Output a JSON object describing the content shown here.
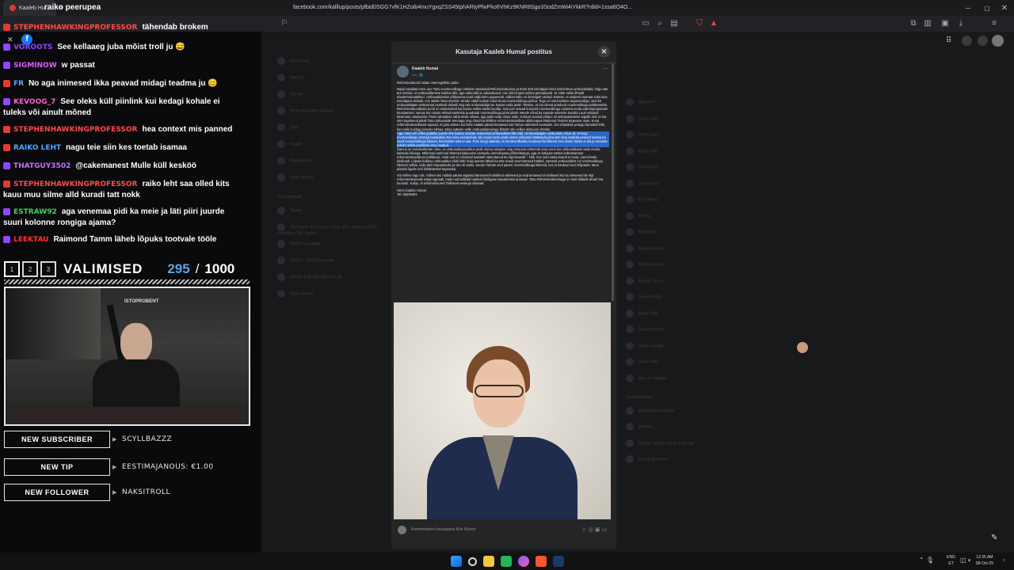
{
  "browser": {
    "tab_title": "Kaaleb Hu...",
    "stream_title": "raiko peerupea",
    "url": "facebook.com/kalllup/posts/pfbid0SGG7vfK1HZoib4muYgxqZSS45tphARtyPfwPko6VhKz9KNR8Sgo3SodZmWi4iYkkR?rdid=1ssa6O4O..."
  },
  "chat": [
    {
      "user": "STEPHENHAWKINGPROFESSOR",
      "text": "tähendab brokem",
      "color": "#ff4a4a",
      "platform": "youtube"
    },
    {
      "user": "VOROOTS",
      "text": "See kellaaeg juba mõist troll ju 😅",
      "color": "#9146ff",
      "platform": "twitch"
    },
    {
      "user": "SIGMINOW",
      "text": "w passat",
      "color": "#e05cff",
      "platform": "twitch"
    },
    {
      "user": "FR",
      "text": "No aga inimesed ikka peavad midagi teadma ju 😊",
      "color": "#4aa8ff",
      "platform": "youtube"
    },
    {
      "user": "KEVOOG_7",
      "text": "See oleks küll piinlink kui kedagi kohale ei tuleks või ainult mõned",
      "color": "#ff5cd2",
      "platform": "twitch"
    },
    {
      "user": "STEPHENHAWKINGPROFESSOR",
      "text": "hea context mis panned",
      "color": "#ff4a4a",
      "platform": "youtube"
    },
    {
      "user": "RAIKO LEHT",
      "text": "nagu teie siin kes toetab isamaa",
      "color": "#4aa8ff",
      "platform": "youtube"
    },
    {
      "user": "THATGUY3502",
      "text": "@cakemanest Mulle küll kesköö",
      "color": "#c070ff",
      "platform": "twitch"
    },
    {
      "user": "STEPHENHAWKINGPROFESSOR",
      "text": "raiko leht saa olled kits kauu muu silme alld kuradi tatt nokk",
      "color": "#ff4a4a",
      "platform": "youtube"
    },
    {
      "user": "ESTRAW92",
      "text": "aga venemaa pidi ka meie ja läti piiri juurde suuri kolonne rongiga ajama?",
      "color": "#3fd15c",
      "platform": "twitch"
    },
    {
      "user": "LEEKTAU",
      "text": "Raimond Tamm läheb lõpuks tootvale tööle",
      "color": "#ff3030",
      "platform": "twitch"
    }
  ],
  "overlay": {
    "tabs": [
      "1",
      "2",
      "3"
    ],
    "title": "VALIMISED",
    "count": "295",
    "slash": "/",
    "total": "1000",
    "cam_label": "ISTOPROBENT",
    "alerts": [
      {
        "label": "NEW SUBSCRIBER",
        "value": "SCYLLBAZZZ"
      },
      {
        "label": "NEW TIP",
        "value": "EESTIMAJANOUS: €1.00"
      },
      {
        "label": "NEW FOLLOWER",
        "value": "NAKSITROLL"
      }
    ]
  },
  "facebook": {
    "left_nav": [
      "Kris Kärner",
      "Meta AI",
      "Sõbrad",
      "Professionaalne töölaud",
      "Vaist",
      "Grupid",
      "Marketplace",
      "Kuva rohkem",
      "Sinu otseteed",
      "Teated",
      "Ühis ma/a: Kris Kärner (Tartu 4EK valimised 2025 - Kandidaat 1/4 - Aston)",
      "ÜKSIV Kooselige",
      "TARTU - Üldis/00 kulaste",
      "ÜDSIK & MÕÕN TARTUS (A)",
      "Kuva rohkem"
    ],
    "right_contacts": [
      "Meta AI P",
      "Saliss Fish",
      "Ümnet Saar",
      "Madis SiIP",
      "Rollo Agoo",
      "Jaanus Kivi",
      "Enel Mang",
      "Ele Sa",
      "Erik Aland",
      "Kaaleb Humal",
      "Kristjan Kosiik",
      "Kaspar Tamm",
      "Leena Rõõps",
      "Martin Pikk",
      "Sandri Hannek",
      "Oliver Kuodde",
      "Ünne Rebo",
      "Ants de Kallaste",
      "Grupivestlused",
      "Maidande Kelnoldsk",
      "Bärenfo",
      "Chadd, Sanlan Karl ja 4 teisega",
      "Uus grupivestlus"
    ],
    "modal_title": "Kasutaja Kaaleb Humal postitus",
    "author": "Kaaleb Humal",
    "time": "1 h · 🌐",
    "post": {
      "p1": "Reformierakond näitas oma tegelikku palet",
      "p2": "Napid nädalad enne uue Tartu noortevolikogu valimist otsustasid Reformierakonna ja Eesti 200 esindajad mind esimehena umbusaldada. Olgu ette ära öeldud, et umbusaldamine kukkus läbi, aga vahendid ja vabandused, mis olid kergeit öeldes jahmatavad. Et mitte öelda lihtsalt ebademokraatlikud. Umbusaldamise põhjusena toodi välja kolm argumenti, millest kaks on ilmselgelt otsitud: Esiteks, et osalesin Isamaa erakonna esindajana debatil, mis rääkis Tartu ööelust. Nende väitel kutsuti mind sinna noortevolikogu juhina. Tegu on naeruväärse argumendiga, sest ka umbusaldajate erakonnad osalesid debatil ning üks umbusaldaja ise kuulas seda pealt. Teiseks, et ma olevat püüdnud noortevolikogu politiseerida. Reformierakondlaste poolt on erakondselt kurioosne sellist väidet kuulda, sest just oravad kutsusid noortevolikogu osalema enda valimisprogrammi koostamisel, samas kui minule tehtud ettehelde puudutab noortevolikogu juhte pikalt. Nende sõnul ka samale esimehe Sandra Lauri esitatud küsimuse eitastamist. Pindu tahetakse näha teiste silmas, aga palki enda omas mitte. Kolmas toodud põhjus oli umbusaldamise tegelik siht: et ma olen tegelenud pikalt Tartu ööbussiide teemaga ning olnud ka kriitiline reformierakondliste abilinnapea Raimond Tamme tegevuse osas. Kuna reformierakondlased tajuvad, et juba vähem kui kahe nädala pärast kaotavad nad Tartus valimised Isamaale, siis üritatakse praegu kartuleid kõik, kes neile kuidagi pinnuks silmas. Mina sattusin selle umbusaldamisega lihtsalt ühe sellise aktsiooni ohvriks.",
      "p3_highlight": "Aga nüüd eriti võika praktika juurde ehk kuidas oravate vedamisel umbusaldust läbi viidi. Umbusaldajate vankumatu nõue oli, et kuigi noortevolikogu istungil kuulatakse ära minu seisukohad, siis sooivi tormi peab olema võimalus hääletada juba ette ning osaleda peavad saama ka need noortevolikogu liikmed, kes kehale tulla ei saa. Pole mingi saladus, et noortevolikokku kuuluvad ka liikmed, kes enam Tartus ei ela ja nendeta poleks sellist positiivse arvu saadud.",
      "p4": "Samuti on ennekuulmatu nõue, et umbusaldusavaldus peab olema salajane ning toimuma vähemalt osas enne kui umbusaldatav saab eneda kaitseks kõnega. Mõlemad sammud lähevad kaljuvastu vastuollu demokraatia põhimõtetega, aga on kahjuks näited sellestsamast reformierakondikust poliitikast, mida nad on viimastel aastatel rakendanud ka riigi tasandil – kõik, kes neid vankumatult ei toeta, saa kõrvale, ekslinadi. Lõpuks kukkus umbusaldus siiski läbi: kuigi avesse läksid ka ette antud anonüümsed hääled, toetasid umbusaldust 14 noortevolikogu liikmest sellise, kaks jäid erapooletuks ja üks oli vastu. Soovin Tartule veel parem noortevolikogu liikmeid, kes ei kaokrud end mõjutada. Mina plaanin ilgeks end häälestustel tegemata.",
      "p5": "Vot selline lugu siis. Vähem kui nädala pärast algavad tänavusel kohalikud valimised ja seal annavad nii tartlased kui ka inimesed üle riigi reformierakonnale selge signaali, mida nad tarlikaid taotlusi õieõiguse kasutamisel arvavad. Tartu Reformierakonnaga on meil üldiselt olnud hea koostöö. Kahju, et reformimoored Tallinnast eeskuju võtavad.",
      "sign1": "Henri Kaaleb Humal",
      "sign2": "Tel: 58250401"
    },
    "comment_placeholder": "Kommenteeri kasutajana Kris Kärner"
  },
  "taskbar": {
    "lang": "ENG",
    "lang2": "ET",
    "time": "12:35 AM",
    "date": "08-Oct-25"
  }
}
